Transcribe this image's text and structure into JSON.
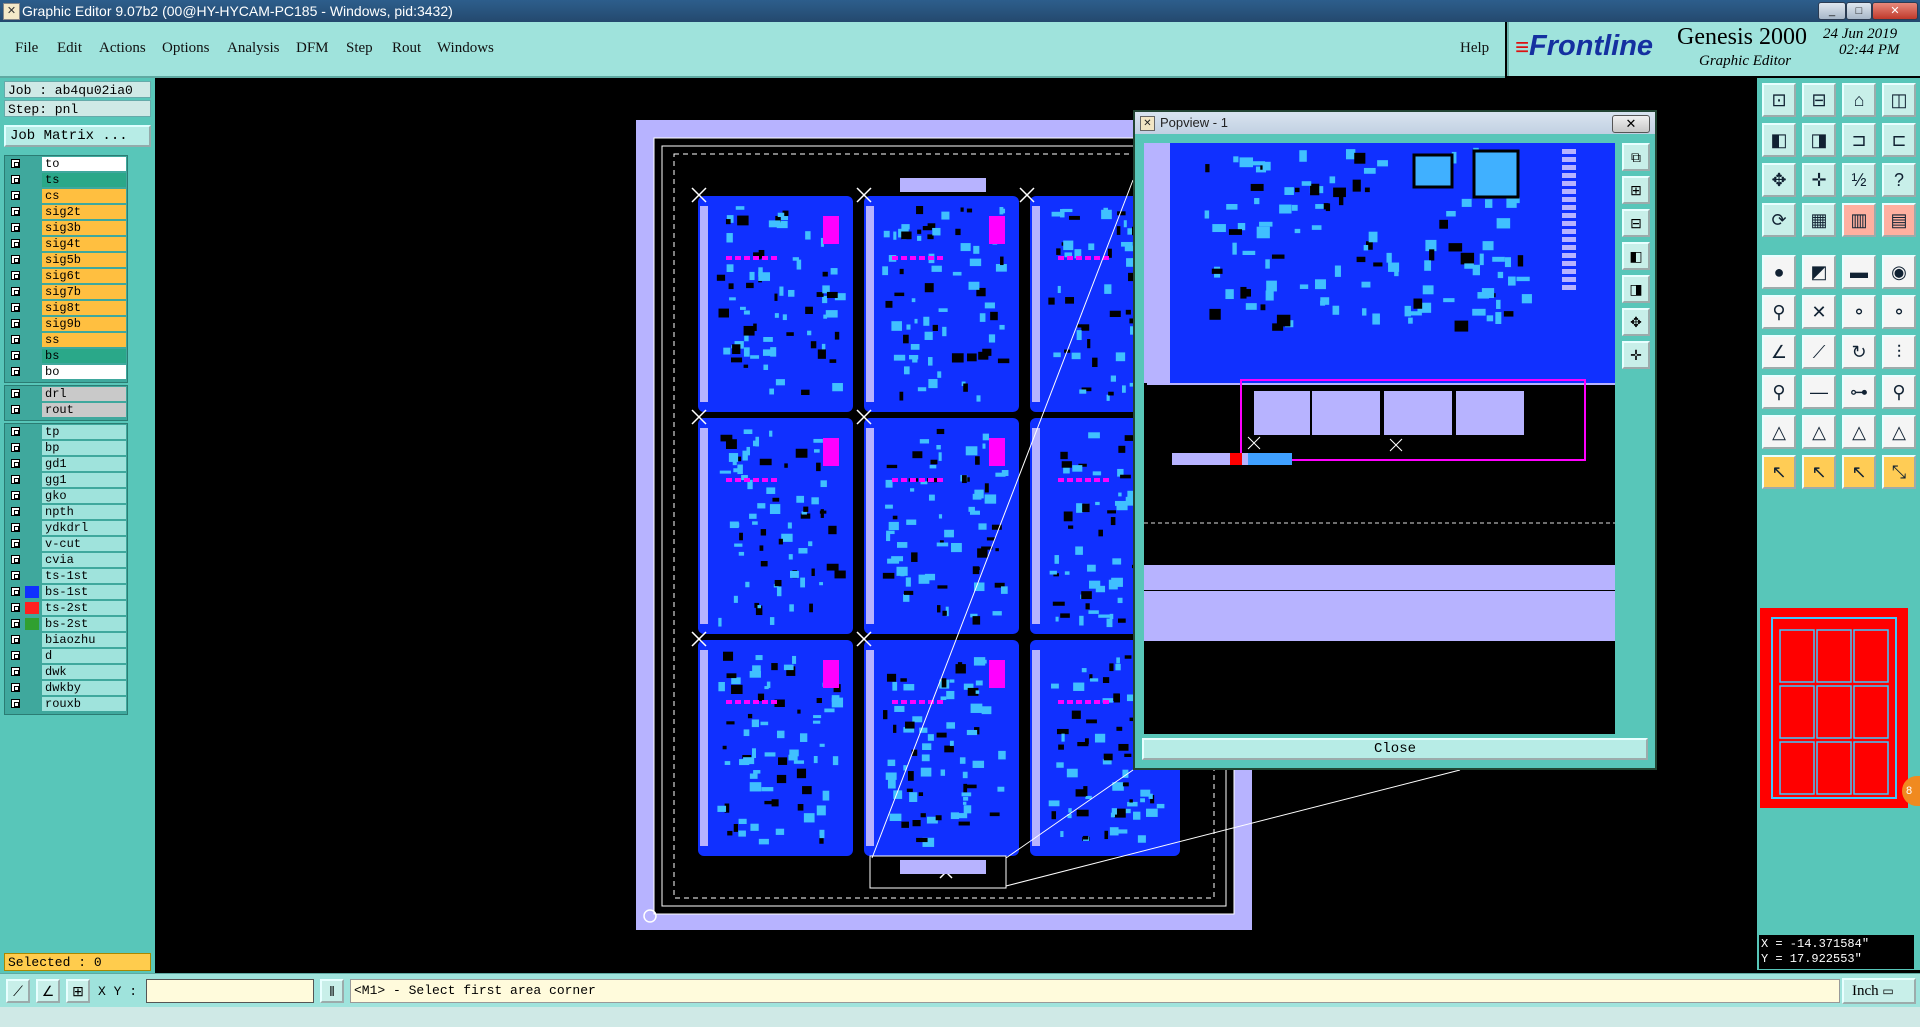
{
  "window": {
    "title": "Graphic Editor 9.07b2 (00@HY-HYCAM-PC185 - Windows, pid:3432)",
    "controls": [
      "_",
      "□",
      "✕"
    ]
  },
  "menu": {
    "items": [
      "File",
      "Edit",
      "Actions",
      "Options",
      "Analysis",
      "DFM",
      "Step",
      "Rout",
      "Windows"
    ],
    "help": "Help"
  },
  "brand": {
    "logo": "Frontline",
    "product": "Genesis 2000",
    "subtitle": "Graphic Editor",
    "date": "24 Jun 2019",
    "time": "02:44 PM"
  },
  "job": {
    "job_line": "Job : ab4qu02ia0",
    "step_line": "Step: pnl",
    "matrix_button": "Job Matrix ..."
  },
  "layers_group1": [
    {
      "name": "to",
      "color": "#ffffff"
    },
    {
      "name": "ts",
      "color": "#2aa889"
    },
    {
      "name": "cs",
      "color": "#ffbf40"
    },
    {
      "name": "sig2t",
      "color": "#ffbf40"
    },
    {
      "name": "sig3b",
      "color": "#ffbf40"
    },
    {
      "name": "sig4t",
      "color": "#ffbf40"
    },
    {
      "name": "sig5b",
      "color": "#ffbf40"
    },
    {
      "name": "sig6t",
      "color": "#ffbf40"
    },
    {
      "name": "sig7b",
      "color": "#ffbf40"
    },
    {
      "name": "sig8t",
      "color": "#ffbf40"
    },
    {
      "name": "sig9b",
      "color": "#ffbf40"
    },
    {
      "name": "ss",
      "color": "#ffbf40"
    },
    {
      "name": "bs",
      "color": "#2aa889"
    },
    {
      "name": "bo",
      "color": "#ffffff"
    }
  ],
  "layers_group2": [
    {
      "name": "drl",
      "color": "#c9c9c9"
    },
    {
      "name": "rout",
      "color": "#c9c9c9"
    }
  ],
  "layers_group3": [
    {
      "name": "tp",
      "color": "#9fe3dc"
    },
    {
      "name": "bp",
      "color": "#9fe3dc"
    },
    {
      "name": "gd1",
      "color": "#9fe3dc"
    },
    {
      "name": "gg1",
      "color": "#9fe3dc"
    },
    {
      "name": "gko",
      "color": "#9fe3dc"
    },
    {
      "name": "npth",
      "color": "#9fe3dc"
    },
    {
      "name": "ydkdrl",
      "color": "#9fe3dc"
    },
    {
      "name": "v-cut",
      "color": "#9fe3dc"
    },
    {
      "name": "cvia",
      "color": "#9fe3dc"
    },
    {
      "name": "ts-1st",
      "color": "#9fe3dc"
    },
    {
      "name": "bs-1st",
      "color": "#9fe3dc",
      "swatch": "#1030ff"
    },
    {
      "name": "ts-2st",
      "color": "#9fe3dc",
      "swatch": "#ff2020"
    },
    {
      "name": "bs-2st",
      "color": "#9fe3dc",
      "swatch": "#30a030"
    },
    {
      "name": "biaozhu",
      "color": "#9fe3dc"
    },
    {
      "name": "d",
      "color": "#9fe3dc"
    },
    {
      "name": "dwk",
      "color": "#9fe3dc"
    },
    {
      "name": "dwkby",
      "color": "#9fe3dc"
    },
    {
      "name": "rouxb",
      "color": "#9fe3dc"
    }
  ],
  "selected": "Selected : 0",
  "popview": {
    "title": "Popview - 1",
    "close_x": "✕",
    "close_button": "Close"
  },
  "coords": {
    "x": "X = -14.371584\"",
    "y": "Y = 17.922553\""
  },
  "status": {
    "xy_label": "X Y :",
    "xy_value": "",
    "prompt": "<M1> - Select first area corner",
    "units": "Inch"
  },
  "minimap_badge": "8"
}
